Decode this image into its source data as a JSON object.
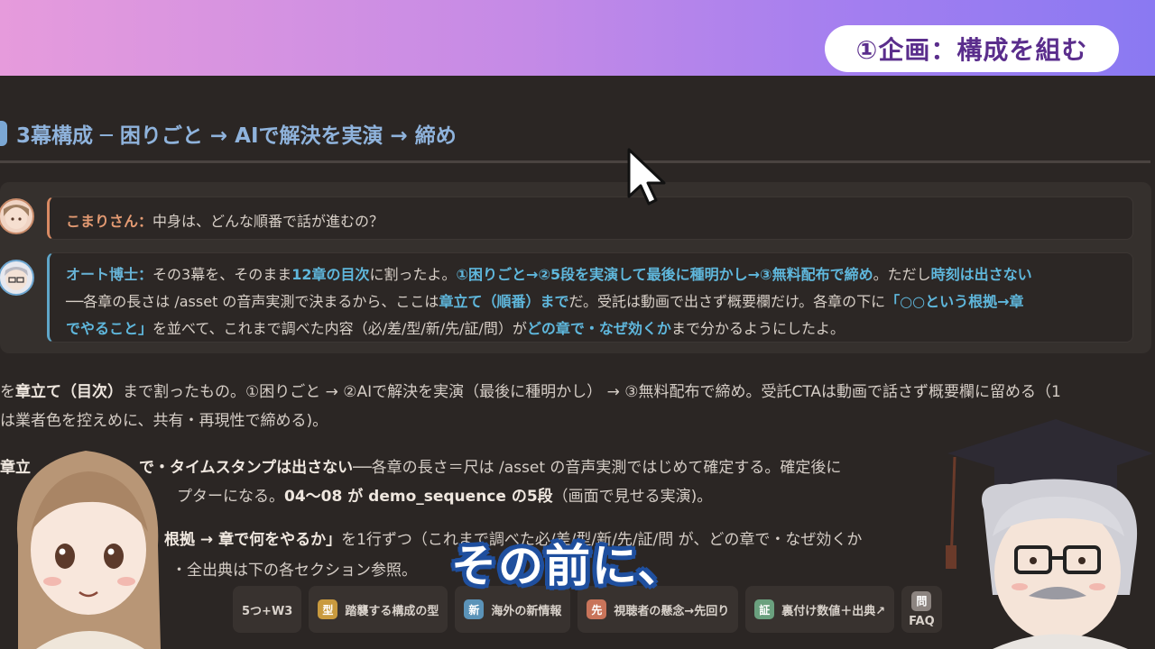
{
  "banner": {
    "section_label": "①企画：構成を組む"
  },
  "doc": {
    "heading": "3幕構成 ─ 困りごと → AIで解決を実演 → 締め",
    "chat": {
      "komari": {
        "speaker": "こまりさん：",
        "message": "中身は、どんな順番で話が進むの？"
      },
      "hakase": {
        "line1": {
          "speaker": "オート博士：",
          "t1": "その3幕を、そのまま",
          "h1": "12章の目次",
          "t2": "に割ったよ。",
          "h2": "①困りごと→②5段を実演して最後に種明かし→③無料配布で締め",
          "t3": "。ただし",
          "h3": "時刻は出さない"
        },
        "line2": {
          "t1": "──各章の長さは /asset の音声実測で決まるから、ここは",
          "h1": "章立て（順番）まで",
          "t2": "だ。受託は動画で出さず概要欄だけ。各章の下に",
          "h2": "「○○という根拠→章"
        },
        "line3": {
          "h1": "でやること」",
          "t1": "を並べて、これまで調べた内容（必/差/型/新/先/証/問）が",
          "h2": "どの章で・なぜ効くか",
          "t2": "まで分かるようにしたよ。"
        }
      }
    },
    "paragraph1": {
      "line1_a": "を",
      "line1_b": "章立て（目次）",
      "line1_c": "まで割ったもの。①困りごと → ②AIで解決を実演（最後に種明かし） → ③無料配布で締め",
      "line1_d": "。受託CTAは動画で話さず概要欄に留める（1",
      "line2": "は業者色を控えめに、共有・再現性で締める)。"
    },
    "paragraph2": {
      "line1_a": "章立",
      "line1_b": "で・タイムスタンプは出さない",
      "line1_c": "──各章の長さ＝尺は /asset の音声実測ではじめて確定する。確定後に",
      "line2_a": "プターになる。",
      "line2_b": "04〜08 が demo_sequence の5段",
      "line2_c": "（画面で見せる実演)。"
    },
    "paragraph3": {
      "line1_a": "根拠 → 章で何をやるか」",
      "line1_b": "を1行ずつ（これまで調べた必/差/型/新/先/証/問 が、どの章で・なぜ効くか",
      "line2": "・全出典は下の各セクション参照。"
    },
    "tags": [
      {
        "badge": "",
        "label": "5つ+W3",
        "color": "#8a7a6a"
      },
      {
        "badge": "型",
        "label": "踏襲する構成の型",
        "color": "#c99a3e"
      },
      {
        "badge": "新",
        "label": "海外の新情報",
        "color": "#5b93b8"
      },
      {
        "badge": "先",
        "label": "視聴者の懸念→先回り",
        "color": "#c8745a"
      },
      {
        "badge": "証",
        "label": "裏付け数値＋出典↗",
        "color": "#6aa07e"
      },
      {
        "badge": "問",
        "label": "FAQ",
        "color": "#8c8480"
      }
    ]
  },
  "subtitle": "その前に、"
}
